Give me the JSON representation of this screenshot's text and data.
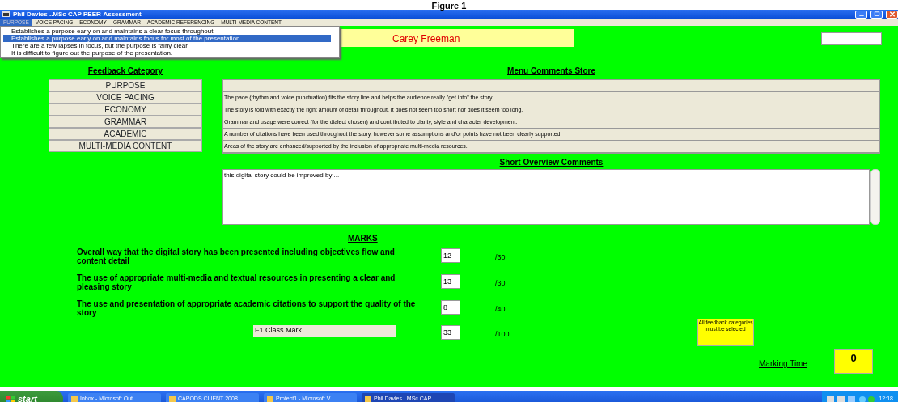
{
  "figure_title": "Figure 1",
  "window": {
    "title": "Phil Davies ..MSc CAP PEER-Assessment"
  },
  "menu": [
    {
      "label": "PURPOSE",
      "selected": true
    },
    {
      "label": "VOICE PACING",
      "selected": false
    },
    {
      "label": "ECONOMY",
      "selected": false
    },
    {
      "label": "GRAMMAR",
      "selected": false
    },
    {
      "label": "ACADEMIC REFERENCING",
      "selected": false
    },
    {
      "label": "MULTI-MEDIA CONTENT",
      "selected": false
    }
  ],
  "dropdown": [
    {
      "text": "Establishes a purpose early on and maintains a clear focus throughout.",
      "selected": false
    },
    {
      "text": "Establishes a purpose early on and maintains focus for most of the presentation.",
      "selected": true
    },
    {
      "text": "There are a few lapses in focus, but the purpose is fairly clear.",
      "selected": false
    },
    {
      "text": "It is difficult to figure out the purpose of the presentation.",
      "selected": false
    }
  ],
  "student": {
    "name": "Carey Freeman"
  },
  "feedback_category": {
    "title": "Feedback Category",
    "items": [
      "PURPOSE",
      "VOICE PACING",
      "ECONOMY",
      "GRAMMAR",
      "ACADEMIC",
      "MULTI-MEDIA CONTENT"
    ]
  },
  "comments_store": {
    "title": "Menu Comments Store",
    "rows": [
      "The pace (rhythm and voice punctuation) fits the story line and helps the audience really \"get into\" the story.",
      "The story is told with exactly the right amount of detail throughout. It does not seem too short nor does it seem too long.",
      "Grammar and usage were correct (for the dialect chosen) and contributed to clarity, style and character development.",
      "A number of citations have been used throughout the story, however some assumptions and/or points have not been clearly supported.",
      "Areas of the story are enhanced/supported by the inclusion of appropriate multi-media resources."
    ]
  },
  "overview": {
    "title": "Short Overview Comments",
    "value": "this digital story could be improved by ..."
  },
  "marks": {
    "title": "MARKS",
    "criteria": [
      {
        "label": "Overall way that the digital story has been presented including objectives flow and content detail",
        "value": "12",
        "out_of": "/30"
      },
      {
        "label": "The use of appropriate multi-media and textual resources in presenting a clear and pleasing story",
        "value": "13",
        "out_of": "/30"
      },
      {
        "label": "The use and presentation of appropriate academic citations to support the quality of the story",
        "value": "8",
        "out_of": "/40"
      }
    ],
    "class_mark": {
      "label": "F1 Class Mark",
      "value": "33",
      "out_of": "/100"
    }
  },
  "note": "All feedback categories must be selected",
  "marking_time": {
    "label": "Marking Time",
    "value": "0"
  },
  "taskbar": {
    "start": "start",
    "tasks": [
      {
        "label": "Inbox - Microsoft Out...",
        "selected": false
      },
      {
        "label": "CAPODS CLIENT 2008",
        "selected": false
      },
      {
        "label": "Protect1 - Microsoft V...",
        "selected": false
      },
      {
        "label": "Phil Davies ..MSc CAP",
        "selected": true
      }
    ],
    "clock": "12:18"
  }
}
